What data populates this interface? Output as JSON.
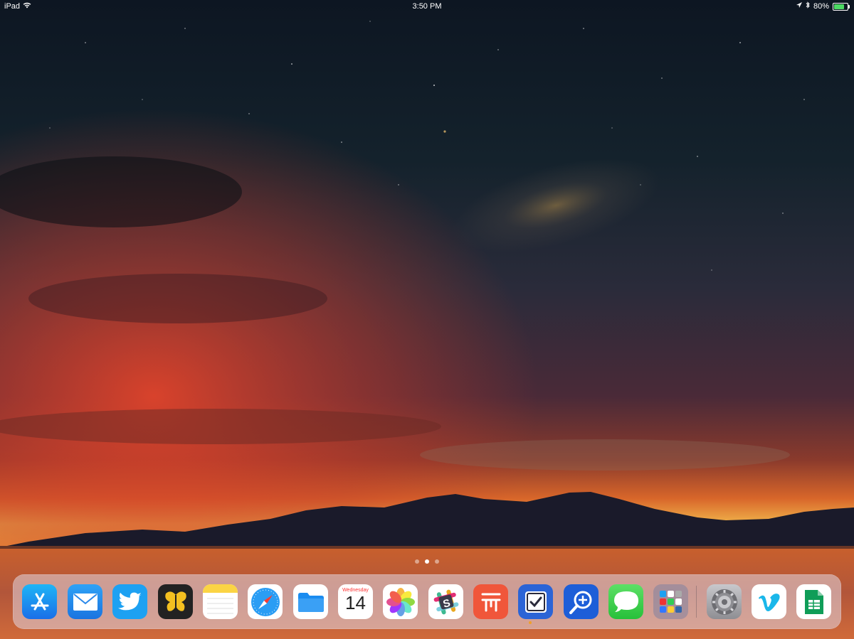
{
  "status_bar": {
    "device": "iPad",
    "time": "3:50 PM",
    "battery": "80%",
    "battery_level": 0.8,
    "icons": [
      "wifi-icon",
      "location-icon",
      "bluetooth-icon",
      "battery-icon"
    ]
  },
  "page_indicator": {
    "pages": 3,
    "current": 2
  },
  "dock": {
    "apps": [
      {
        "name": "App Store",
        "icon": "app-store-icon"
      },
      {
        "name": "Mail",
        "icon": "mail-icon"
      },
      {
        "name": "Twitter",
        "icon": "twitter-icon"
      },
      {
        "name": "Tes",
        "icon": "butterfly-icon"
      },
      {
        "name": "Notes",
        "icon": "notes-icon"
      },
      {
        "name": "Safari",
        "icon": "safari-icon"
      },
      {
        "name": "Files",
        "icon": "files-icon"
      },
      {
        "name": "Calendar",
        "icon": "calendar-icon",
        "day_name": "Wednesday",
        "day_number": "14"
      },
      {
        "name": "Photos",
        "icon": "photos-icon"
      },
      {
        "name": "Slack",
        "icon": "slack-icon"
      },
      {
        "name": "Workflow",
        "icon": "workflow-icon"
      },
      {
        "name": "Things",
        "icon": "checkbox-icon",
        "running": true
      },
      {
        "name": "Magnifier",
        "icon": "magnifier-icon"
      },
      {
        "name": "Messages",
        "icon": "messages-icon"
      },
      {
        "name": "Folder",
        "icon": "folder-icon"
      },
      {
        "name": "Settings",
        "icon": "settings-icon"
      },
      {
        "name": "Vimeo",
        "icon": "vimeo-icon"
      },
      {
        "name": "Sheets",
        "icon": "sheets-icon"
      }
    ]
  },
  "colors": {
    "battery_fill": "#4cd964",
    "running_indicator": "#f0a028"
  }
}
